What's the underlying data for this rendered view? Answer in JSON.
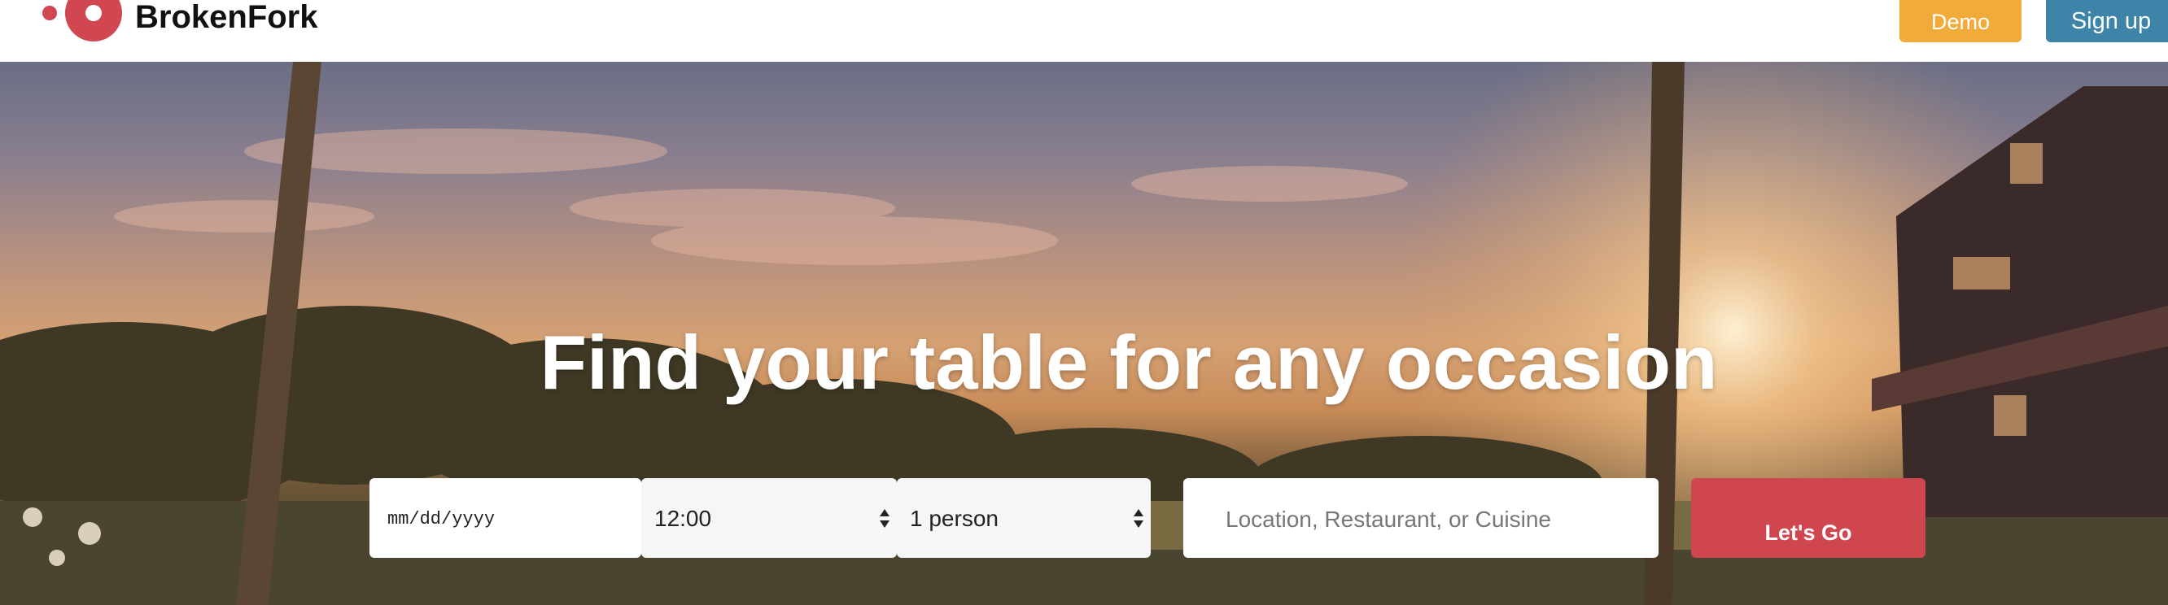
{
  "header": {
    "brand": "BrokenFork",
    "demo_label": "Demo",
    "signup_label": "Sign up"
  },
  "hero": {
    "headline": "Find your table for any occasion"
  },
  "search": {
    "date_placeholder": "mm/dd/yyyy",
    "time_value": "12:00",
    "party_value": "1 person",
    "query_placeholder": "Location, Restaurant, or Cuisine",
    "submit_label": "Let's Go"
  },
  "colors": {
    "brand_red": "#d04651",
    "demo_orange": "#f0ab3a",
    "signup_blue": "#3d84a8"
  },
  "icons": [
    "logo-icon",
    "select-arrows-icon"
  ]
}
